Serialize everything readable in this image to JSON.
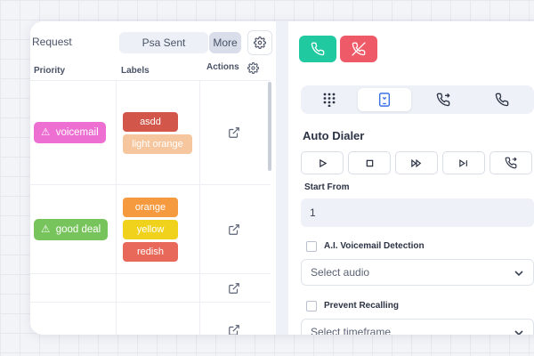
{
  "topbar": {
    "request": "Request",
    "psa_sent": "Psa Sent",
    "more": "More"
  },
  "table": {
    "headers": {
      "priority": "Priority",
      "labels": "Labels",
      "actions": "Actions"
    },
    "rows": [
      {
        "priority": "voicemail",
        "priority_color": "#ec6fd1",
        "labels": [
          {
            "text": "asdd",
            "color": "#d2574a"
          },
          {
            "text": "light orange",
            "color": "#f6c79e"
          }
        ]
      },
      {
        "priority": "good deal",
        "priority_color": "#78c45c",
        "labels": [
          {
            "text": "orange",
            "color": "#f59a3e"
          },
          {
            "text": "yellow",
            "color": "#f0d21c"
          },
          {
            "text": "redish",
            "color": "#e8685a"
          }
        ]
      },
      {
        "priority": "",
        "labels": []
      },
      {
        "priority": "",
        "labels": []
      }
    ]
  },
  "dialer": {
    "call_colors": {
      "accept": "#21c9a0",
      "reject": "#ee5a68"
    },
    "title": "Auto Dialer",
    "start_from_label": "Start From",
    "start_from_value": "1",
    "voicemail_detection_label": "A.I. Voicemail Detection",
    "select_audio_placeholder": "Select audio",
    "prevent_recalling_label": "Prevent Recalling",
    "select_timeframe_placeholder": "Select timeframe"
  }
}
